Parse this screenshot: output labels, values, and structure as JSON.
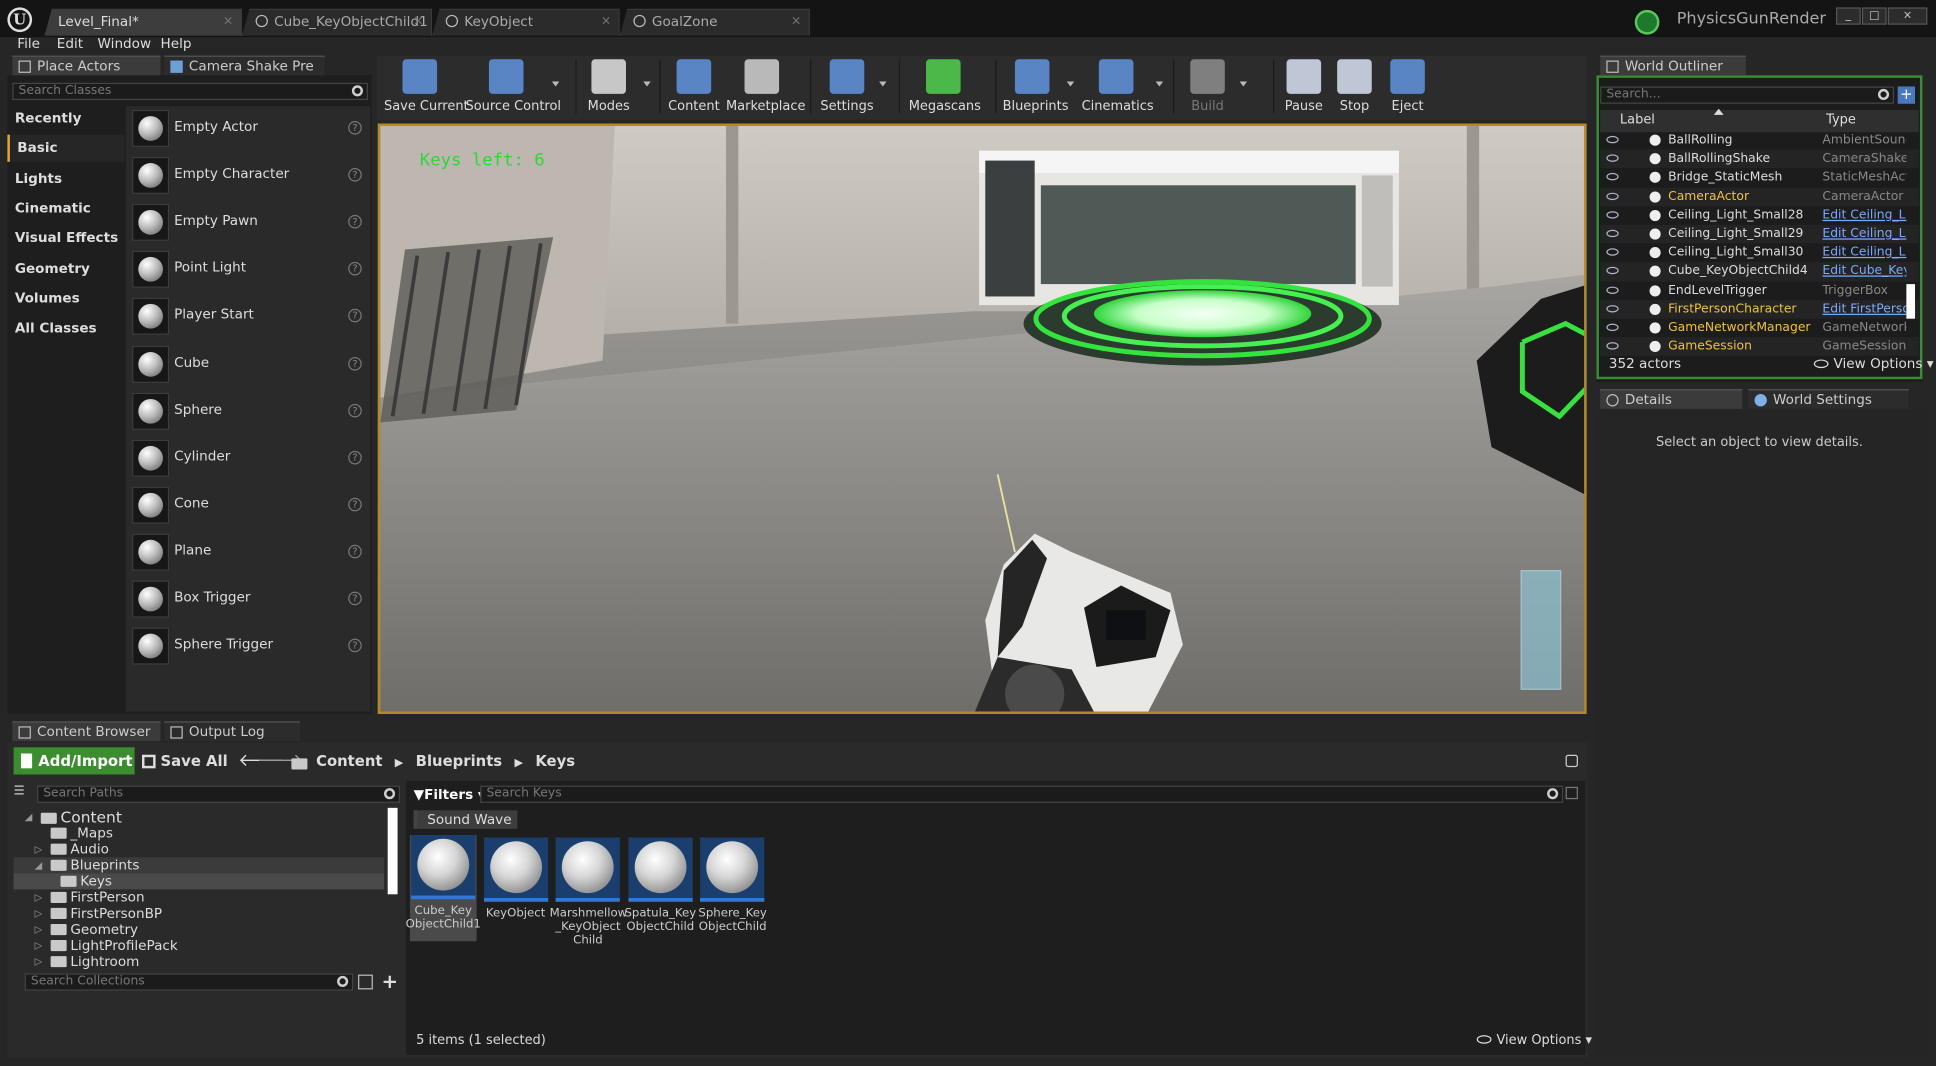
{
  "window": {
    "project_name": "PhysicsGunRender",
    "controls": {
      "minimize": "_",
      "maximize": "□",
      "close": "×"
    }
  },
  "doc_tabs": [
    {
      "label": "Level_Final*"
    },
    {
      "label": "Cube_KeyObjectChild1"
    },
    {
      "label": "KeyObject"
    },
    {
      "label": "GoalZone"
    }
  ],
  "menu": [
    "File",
    "Edit",
    "Window",
    "Help"
  ],
  "place_actors": {
    "tab_label": "Place Actors",
    "tab2_label": "Camera Shake Pre",
    "search_placeholder": "Search Classes",
    "categories": [
      "Recently Placed",
      "Basic",
      "Lights",
      "Cinematic",
      "Visual Effects",
      "Geometry",
      "Volumes",
      "All Classes"
    ],
    "selected_category": "Basic",
    "actors": [
      "Empty Actor",
      "Empty Character",
      "Empty Pawn",
      "Point Light",
      "Player Start",
      "Cube",
      "Sphere",
      "Cylinder",
      "Cone",
      "Plane",
      "Box Trigger",
      "Sphere Trigger"
    ],
    "help_glyph": "?"
  },
  "toolbar": [
    {
      "label": "Save Current",
      "icon": "save-icon"
    },
    {
      "label": "Source Control",
      "icon": "source-control-icon"
    },
    {
      "label": "Modes",
      "icon": "modes-icon"
    },
    {
      "label": "Content",
      "icon": "content-icon"
    },
    {
      "label": "Marketplace",
      "icon": "marketplace-icon"
    },
    {
      "label": "Settings",
      "icon": "settings-icon"
    },
    {
      "label": "Megascans",
      "icon": "megascans-icon"
    },
    {
      "label": "Blueprints",
      "icon": "blueprints-icon"
    },
    {
      "label": "Cinematics",
      "icon": "cinematics-icon"
    },
    {
      "label": "Build",
      "icon": "build-icon"
    },
    {
      "label": "Pause",
      "icon": "pause-icon"
    },
    {
      "label": "Stop",
      "icon": "stop-icon"
    },
    {
      "label": "Eject",
      "icon": "eject-icon"
    }
  ],
  "viewport": {
    "hud_text": "Keys left: 6"
  },
  "outliner": {
    "tab_label": "World Outliner",
    "search_placeholder": "Search...",
    "col_label": "Label",
    "col_type": "Type",
    "rows": [
      {
        "label": "BallRolling",
        "type": "AmbientSound",
        "link": false,
        "gold": false
      },
      {
        "label": "BallRollingShake",
        "type": "CameraShakeS",
        "link": false,
        "gold": false
      },
      {
        "label": "Bridge_StaticMesh",
        "type": "StaticMeshActo",
        "link": false,
        "gold": false
      },
      {
        "label": "CameraActor",
        "type": "CameraActor",
        "link": false,
        "gold": true
      },
      {
        "label": "Ceiling_Light_Small28",
        "type": "Edit Ceiling_Lig",
        "link": true,
        "gold": false
      },
      {
        "label": "Ceiling_Light_Small29",
        "type": "Edit Ceiling_Lig",
        "link": true,
        "gold": false
      },
      {
        "label": "Ceiling_Light_Small30",
        "type": "Edit Ceiling_Lig",
        "link": true,
        "gold": false
      },
      {
        "label": "Cube_KeyObjectChild4",
        "type": "Edit Cube_Key",
        "link": true,
        "gold": false
      },
      {
        "label": "EndLevelTrigger",
        "type": "TriggerBox",
        "link": false,
        "gold": false
      },
      {
        "label": "FirstPersonCharacter",
        "type": "Edit FirstPerso",
        "link": true,
        "gold": true
      },
      {
        "label": "GameNetworkManager",
        "type": "GameNetworkM",
        "link": false,
        "gold": true
      },
      {
        "label": "GameSession",
        "type": "GameSession",
        "link": false,
        "gold": true
      }
    ],
    "count": "352 actors",
    "view_options": "View Options"
  },
  "details": {
    "tab_label": "Details",
    "tab2_label": "World Settings",
    "empty_text": "Select an object to view details."
  },
  "content_browser": {
    "tab_label": "Content Browser",
    "tab2_label": "Output Log",
    "add_import": "Add/Import",
    "save_all": "Save All",
    "breadcrumb": [
      "Content",
      "Blueprints",
      "Keys"
    ],
    "paths_placeholder": "Search Paths",
    "filters_label": "Filters",
    "keys_placeholder": "Search Keys",
    "filter_chip": "Sound Wave",
    "tree": [
      {
        "label": "Content",
        "depth": 0,
        "expanded": true,
        "root": true
      },
      {
        "label": "_Maps",
        "depth": 1
      },
      {
        "label": "Audio",
        "depth": 1,
        "expander": true
      },
      {
        "label": "Blueprints",
        "depth": 1,
        "expanded": true,
        "hl": true
      },
      {
        "label": "Keys",
        "depth": 2,
        "sel": true
      },
      {
        "label": "FirstPerson",
        "depth": 1,
        "expander": true
      },
      {
        "label": "FirstPersonBP",
        "depth": 1,
        "expander": true
      },
      {
        "label": "Geometry",
        "depth": 1,
        "expander": true
      },
      {
        "label": "LightProfilePack",
        "depth": 1,
        "expander": true
      },
      {
        "label": "Lightroom",
        "depth": 1,
        "expander": true
      }
    ],
    "collections_placeholder": "Search Collections",
    "assets": [
      {
        "label": "Cube_Key ObjectChild1",
        "sel": true
      },
      {
        "label": "KeyObject"
      },
      {
        "label": "Marshmellow _KeyObject Child"
      },
      {
        "label": "Spatula_Key ObjectChild"
      },
      {
        "label": "Sphere_Key ObjectChild"
      }
    ],
    "status": "5 items (1 selected)",
    "view_options": "View Options"
  },
  "colors": {
    "accent": "#e1a73b",
    "green": "#3c8d2f",
    "link": "#7aa9ff",
    "hud": "#2fd63a"
  }
}
